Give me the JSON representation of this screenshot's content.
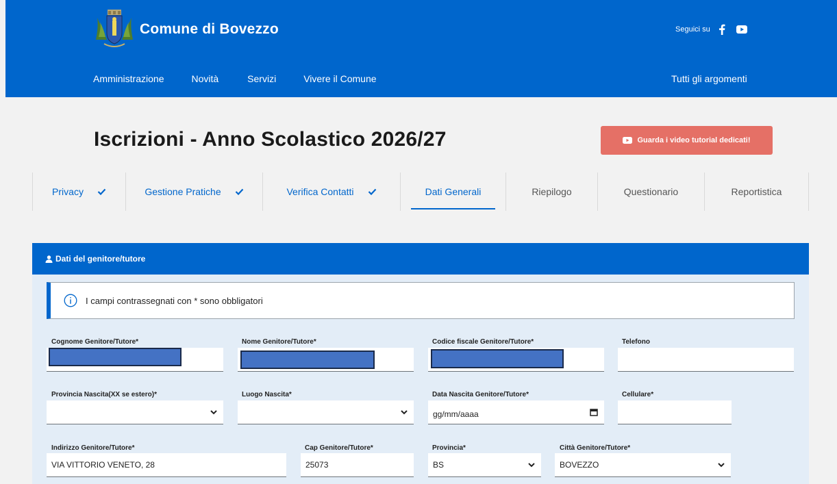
{
  "header": {
    "site_name": "Comune di Bovezzo",
    "follow_label": "Seguici su",
    "social": [
      "facebook-icon",
      "youtube-icon"
    ],
    "nav": [
      "Amministrazione",
      "Novità",
      "Servizi",
      "Vivere il Comune"
    ],
    "nav_right": "Tutti gli argomenti",
    "colors": {
      "primary": "#0066cc",
      "accent": "#e57066"
    }
  },
  "page": {
    "title": "Iscrizioni - Anno Scolastico 2026/27",
    "video_button": "Guarda i video tutorial dedicati!"
  },
  "tabs": [
    {
      "label": "Privacy",
      "status": "done"
    },
    {
      "label": "Gestione Pratiche",
      "status": "done"
    },
    {
      "label": "Verifica Contatti",
      "status": "done"
    },
    {
      "label": "Dati Generali",
      "status": "active"
    },
    {
      "label": "Riepilogo",
      "status": "pending"
    },
    {
      "label": "Questionario",
      "status": "pending"
    },
    {
      "label": "Reportistica",
      "status": "pending"
    }
  ],
  "form": {
    "section_title": "Dati del genitore/tutore",
    "notice": "I campi contrassegnati con * sono obbligatori",
    "fields": {
      "cognome": {
        "label": "Cognome Genitore/Tutore*",
        "value": ""
      },
      "nome": {
        "label": "Nome Genitore/Tutore*",
        "value": ""
      },
      "codice_fiscale": {
        "label": "Codice fiscale Genitore/Tutore*",
        "value": ""
      },
      "telefono": {
        "label": "Telefono",
        "value": ""
      },
      "provincia_nascita": {
        "label": "Provincia Nascita(XX se estero)*",
        "value": ""
      },
      "luogo_nascita": {
        "label": "Luogo Nascita*",
        "value": ""
      },
      "data_nascita": {
        "label": "Data Nascita Genitore/Tutore*",
        "value": "gg/mm/aaaa"
      },
      "cellulare": {
        "label": "Cellulare*",
        "value": ""
      },
      "indirizzo": {
        "label": "Indirizzo Genitore/Tutore*",
        "value": "VIA VITTORIO VENETO, 28"
      },
      "cap": {
        "label": "Cap Genitore/Tutore*",
        "value": "25073"
      },
      "provincia": {
        "label": "Provincia*",
        "value": "BS"
      },
      "citta": {
        "label": "Città Genitore/Tutore*",
        "value": "BOVEZZO"
      }
    }
  }
}
